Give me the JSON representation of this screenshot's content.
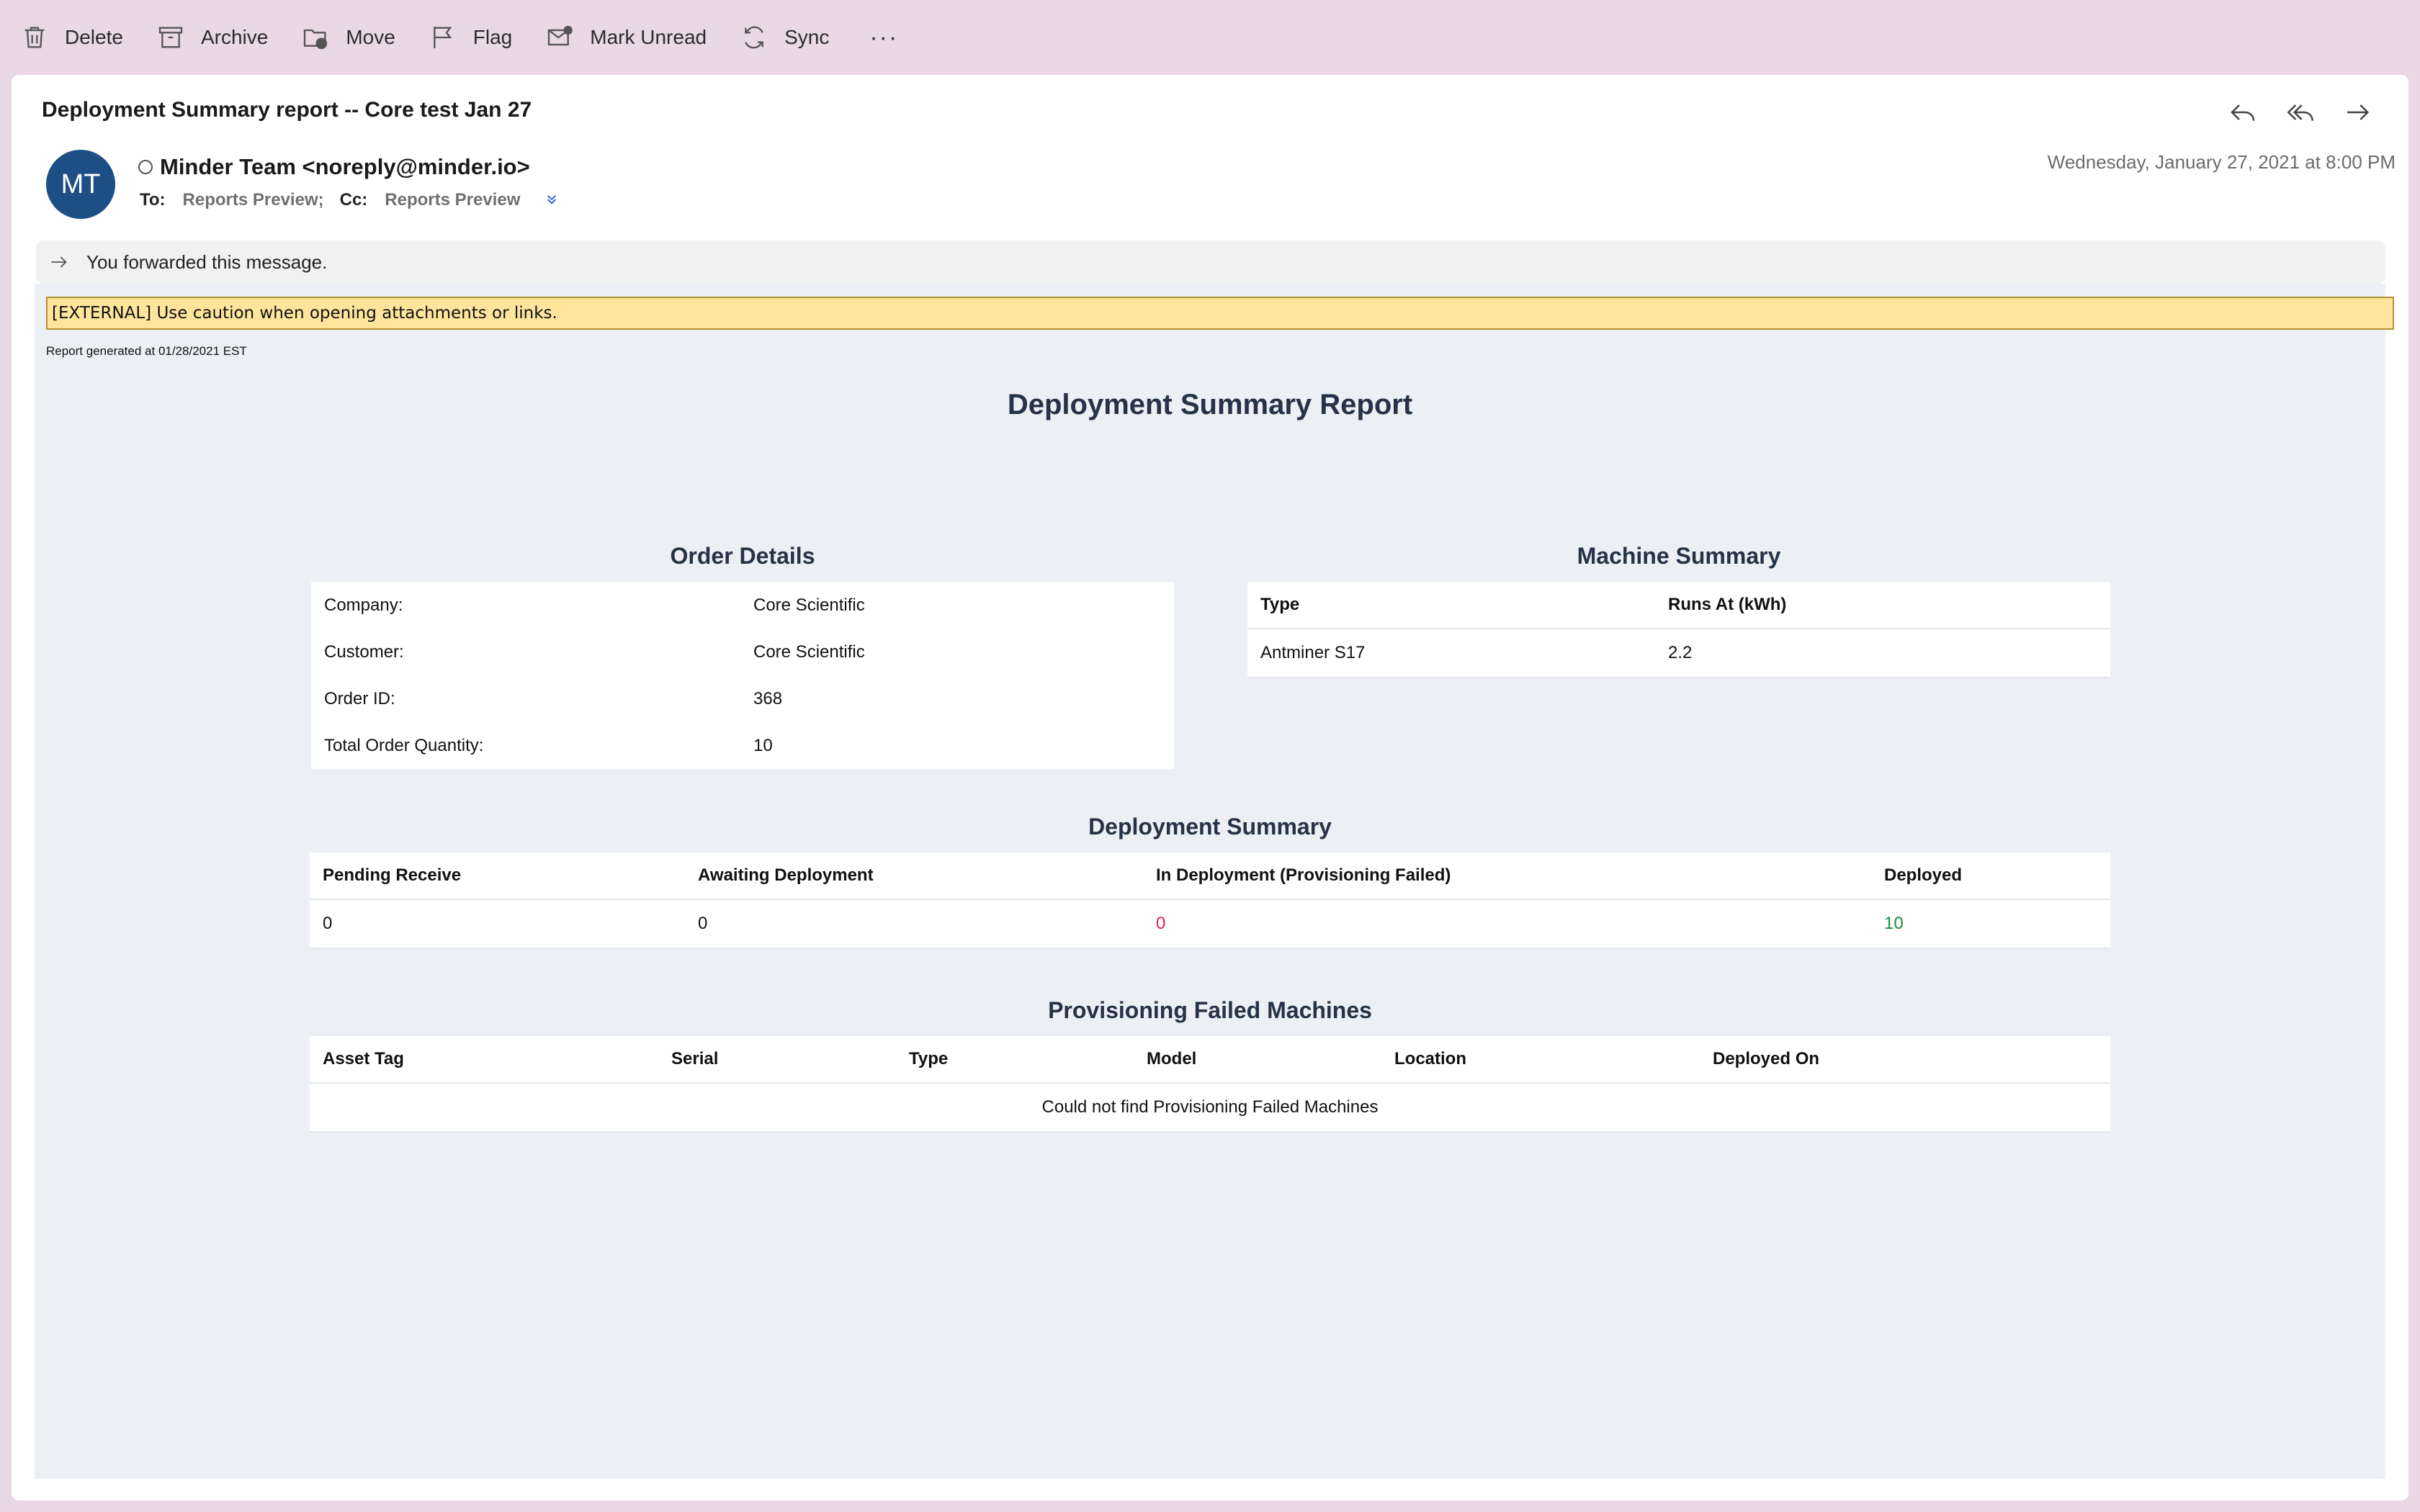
{
  "toolbar": {
    "delete": "Delete",
    "archive": "Archive",
    "move": "Move",
    "flag": "Flag",
    "mark_unread": "Mark Unread",
    "sync": "Sync",
    "more": "···"
  },
  "message": {
    "subject": "Deployment Summary report -- Core test Jan 27",
    "avatar_initials": "MT",
    "avatar_color": "#1d4f86",
    "sender": "Minder Team <noreply@minder.io>",
    "to_label": "To:",
    "to_value": "Reports Preview;",
    "cc_label": "Cc:",
    "cc_value": "Reports Preview",
    "date": "Wednesday, January 27, 2021 at 8:00 PM",
    "forwarded_notice": "You forwarded this message."
  },
  "body": {
    "external_banner": "[EXTERNAL] Use caution when opening attachments or links.",
    "generated": "Report generated at 01/28/2021 EST",
    "report_title": "Deployment Summary Report",
    "order_details": {
      "title": "Order Details",
      "rows": [
        {
          "label": "Company:",
          "value": "Core Scientific"
        },
        {
          "label": "Customer:",
          "value": "Core Scientific"
        },
        {
          "label": "Order ID:",
          "value": "368"
        },
        {
          "label": "Total Order Quantity:",
          "value": "10"
        }
      ]
    },
    "machine_summary": {
      "title": "Machine Summary",
      "headers": [
        "Type",
        "Runs At (kWh)"
      ],
      "rows": [
        [
          "Antminer S17",
          "2.2"
        ]
      ]
    },
    "deployment_summary": {
      "title": "Deployment Summary",
      "headers": [
        "Pending Receive",
        "Awaiting Deployment",
        "In Deployment (Provisioning Failed)",
        "Deployed"
      ],
      "values": [
        "0",
        "0",
        "0",
        "10"
      ]
    },
    "provisioning_failed": {
      "title": "Provisioning Failed Machines",
      "headers": [
        "Asset Tag",
        "Serial",
        "Type",
        "Model",
        "Location",
        "Deployed On"
      ],
      "empty_message": "Could not find Provisioning Failed Machines"
    }
  }
}
